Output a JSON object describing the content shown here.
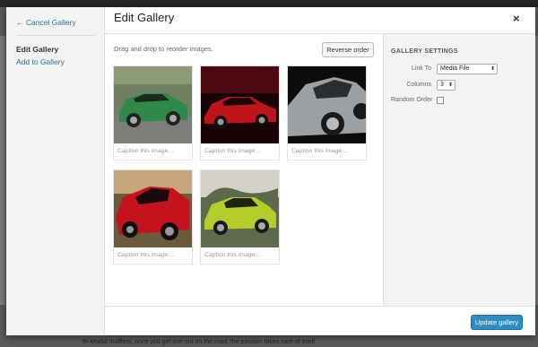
{
  "modal": {
    "title": "Edit Gallery",
    "close_glyph": "×"
  },
  "menu": {
    "cancel": "← Cancel Gallery",
    "edit": "Edit Gallery",
    "add": "Add to Gallery"
  },
  "content": {
    "hint": "Drag and drop to reorder images.",
    "reverse_label": "Reverse order",
    "images": [
      {
        "caption_placeholder": "Caption this image…",
        "car_color": "#2f8a4a"
      },
      {
        "caption_placeholder": "Caption this image…",
        "car_color": "#c0141c"
      },
      {
        "caption_placeholder": "Caption this image…",
        "car_color": "#9aa0a4"
      },
      {
        "caption_placeholder": "Caption this image…",
        "car_color": "#c4131d"
      },
      {
        "caption_placeholder": "Caption this image…",
        "car_color": "#b6cc2a"
      }
    ]
  },
  "settings": {
    "heading": "GALLERY SETTINGS",
    "link_to_label": "Link To",
    "link_to_value": "Media File",
    "columns_label": "Columns",
    "columns_value": "3",
    "random_order_label": "Random Order",
    "random_order_checked": false
  },
  "footer": {
    "update_label": "Update gallery"
  },
  "background": {
    "text": "Bi-Modal mufflers, once you get one out on the road, the passion takes care of itself"
  }
}
